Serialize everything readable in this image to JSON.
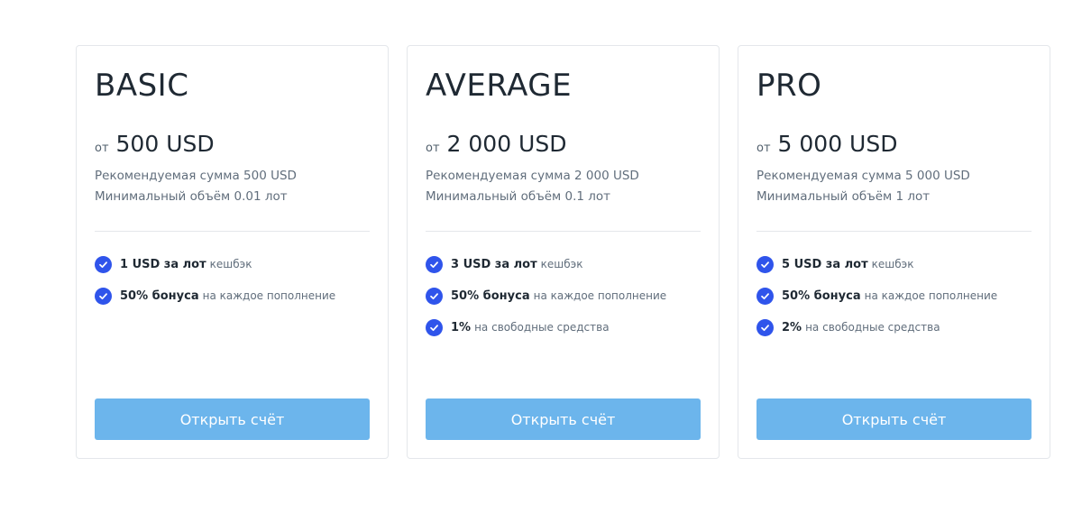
{
  "plans": [
    {
      "name": "BASIC",
      "price_from": "от",
      "price_amount": "500 USD",
      "recommended": "Рекомендуемая сумма 500 USD",
      "min_volume": "Минимальный объём 0.01 лот",
      "features": [
        {
          "strong": "1 USD за лот",
          "note": "кешбэк"
        },
        {
          "strong": "50% бонуса",
          "note": "на каждое пополнение"
        }
      ],
      "button_label": "Открыть счёт"
    },
    {
      "name": "AVERAGE",
      "price_from": "от",
      "price_amount": "2 000 USD",
      "recommended": "Рекомендуемая сумма 2 000 USD",
      "min_volume": "Минимальный объём 0.1 лот",
      "features": [
        {
          "strong": "3 USD за лот",
          "note": "кешбэк"
        },
        {
          "strong": "50% бонуса",
          "note": "на каждое пополнение"
        },
        {
          "strong": "1%",
          "note": "на свободные средства"
        }
      ],
      "button_label": "Открыть счёт"
    },
    {
      "name": "PRO",
      "price_from": "от",
      "price_amount": "5 000 USD",
      "recommended": "Рекомендуемая сумма 5 000 USD",
      "min_volume": "Минимальный объём 1 лот",
      "features": [
        {
          "strong": "5 USD за лот",
          "note": "кешбэк"
        },
        {
          "strong": "50% бонуса",
          "note": "на каждое пополнение"
        },
        {
          "strong": "2%",
          "note": "на свободные средства"
        }
      ],
      "button_label": "Открыть счёт"
    }
  ],
  "colors": {
    "check_icon": "#2f54eb",
    "button_bg": "#6cb5ec",
    "card_border": "#e4e7eb"
  },
  "icons": {
    "feature": "check-circle-icon"
  }
}
